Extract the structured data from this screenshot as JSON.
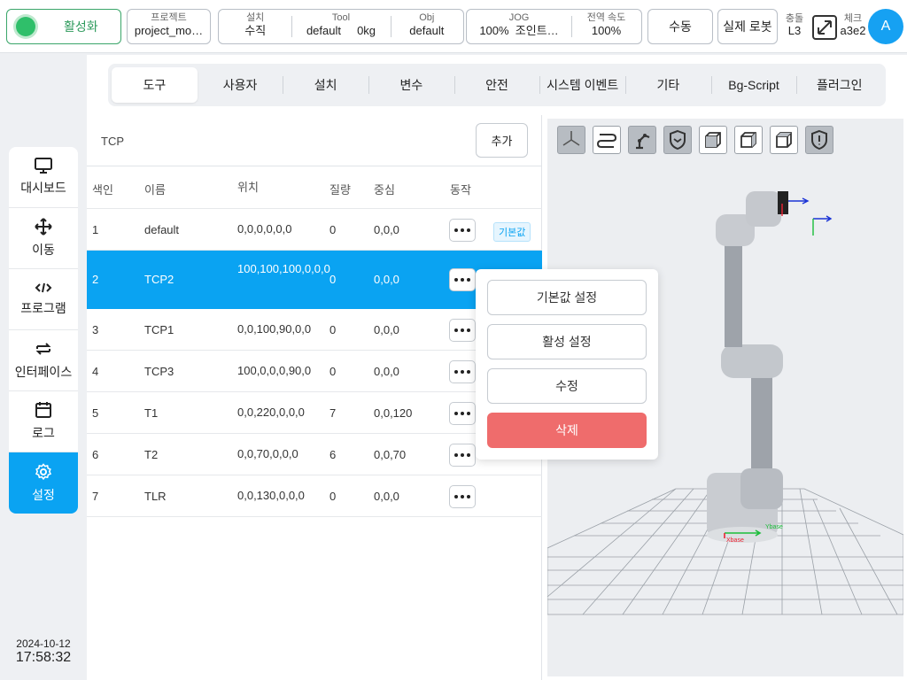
{
  "topbar": {
    "activate_label": "활성화",
    "project_caption": "프로젝트",
    "project_value": "project_mo…",
    "install_caption": "설치",
    "install_value": "수직",
    "tool_caption": "Tool",
    "tool_value": "default",
    "tool_mass": "0kg",
    "obj_caption": "Obj",
    "obj_value": "default",
    "jog_caption": "JOG",
    "jog_value": "100%",
    "jog_mode": "조인트…",
    "speed_caption": "전역 속도",
    "speed_value": "100%",
    "manual_label": "수동",
    "real_robot_label": "실제 로봇",
    "collision_caption": "충돌",
    "collision_value": "L3",
    "check_caption": "체크",
    "check_value": "a3e2",
    "avatar_letter": "A"
  },
  "nav": {
    "items": [
      {
        "label": "대시보드",
        "icon": "monitor-icon"
      },
      {
        "label": "이동",
        "icon": "move-icon"
      },
      {
        "label": "프로그램",
        "icon": "code-icon"
      },
      {
        "label": "인터페이스",
        "icon": "swap-icon"
      },
      {
        "label": "로그",
        "icon": "calendar-icon"
      },
      {
        "label": "설정",
        "icon": "gear-icon"
      }
    ],
    "date": "2024-10-12",
    "time": "17:58:32"
  },
  "tabs": [
    "도구",
    "사용자",
    "설치",
    "변수",
    "안전",
    "시스템 이벤트",
    "기타",
    "Bg-Script",
    "플러그인"
  ],
  "tcp": {
    "title": "TCP",
    "add_label": "추가",
    "headers": [
      "색인",
      "이름",
      "위치",
      "질량",
      "중심",
      "동작"
    ],
    "rows": [
      {
        "idx": "1",
        "name": "default",
        "pos": "0,0,0,0,0,0",
        "mass": "0",
        "center": "0,0,0",
        "badge": "기본값"
      },
      {
        "idx": "2",
        "name": "TCP2",
        "pos": "100,100,100,0,0,0",
        "mass": "0",
        "center": "0,0,0"
      },
      {
        "idx": "3",
        "name": "TCP1",
        "pos": "0,0,100,90,0,0",
        "mass": "0",
        "center": "0,0,0"
      },
      {
        "idx": "4",
        "name": "TCP3",
        "pos": "100,0,0,0,90,0",
        "mass": "0",
        "center": "0,0,0"
      },
      {
        "idx": "5",
        "name": "T1",
        "pos": "0,0,220,0,0,0",
        "mass": "7",
        "center": "0,0,120"
      },
      {
        "idx": "6",
        "name": "T2",
        "pos": "0,0,70,0,0,0",
        "mass": "6",
        "center": "0,0,70"
      },
      {
        "idx": "7",
        "name": "TLR",
        "pos": "0,0,130,0,0,0",
        "mass": "0",
        "center": "0,0,0"
      }
    ]
  },
  "popup": {
    "set_default": "기본값 설정",
    "set_active": "활성 설정",
    "edit": "수정",
    "delete": "삭제"
  },
  "view3d": {
    "tools": [
      "axes-icon",
      "path-icon",
      "robot-arm-icon",
      "shield-icon",
      "cube-front-icon",
      "cube-iso-icon",
      "cube-side-icon",
      "safety-shield-icon"
    ],
    "x_label": "Xbase",
    "y_label": "Ybase"
  },
  "colors": {
    "accent": "#0aa3f2",
    "active_green": "#2fbf6a",
    "danger": "#ef6c6c"
  }
}
